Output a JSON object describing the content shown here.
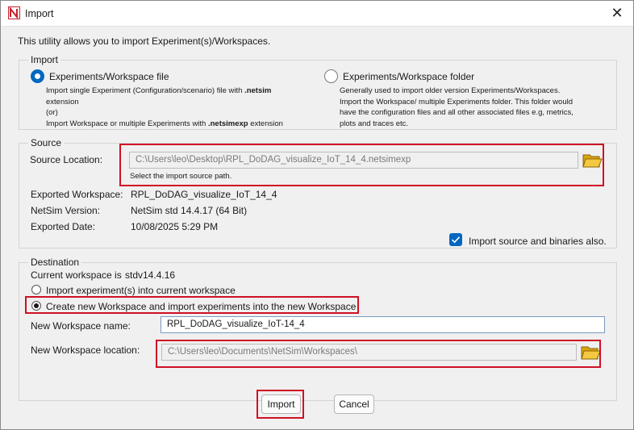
{
  "window": {
    "title": "Import",
    "app_icon": "netsim-logo-icon",
    "close_icon": "close-icon"
  },
  "intro": "This utility allows you to import Experiment(s)/Workspaces.",
  "import_group": {
    "title": "Import",
    "file_option": {
      "label": "Experiments/Workspace file",
      "selected": true,
      "desc": {
        "line1_pre": "Import single Experiment (Configuration/scenario) file with ",
        "line1_bold": ".netsim",
        "line2": "extension",
        "line3": "(or)",
        "line4_pre": "Import Workspace or multiple Experiments with ",
        "line4_bold": ".netsimexp",
        "line4_post": " extension"
      }
    },
    "folder_option": {
      "label": "Experiments/Workspace folder",
      "selected": false,
      "desc": {
        "line1": "Generally used to import older version Experiments/Workspaces.",
        "line2": "Import the Workspace/ multiple Experiments folder. This folder would",
        "line3": "have the configuration files and all other associated files e.g, metrics,",
        "line4": "plots and traces etc."
      }
    }
  },
  "source_group": {
    "title": "Source",
    "location_label": "Source Location:",
    "location_value": "C:\\Users\\leo\\Desktop\\RPL_DoDAG_visualize_IoT_14_4.netsimexp",
    "hint": "Select the import source path.",
    "folder_icon": "folder-icon",
    "exported_workspace_label": "Exported Workspace:",
    "exported_workspace_value": "RPL_DoDAG_visualize_IoT_14_4",
    "netsim_version_label": "NetSim Version:",
    "netsim_version_value": "NetSim std 14.4.17 (64 Bit)",
    "exported_date_label": "Exported Date:",
    "exported_date_value": "10/08/2025 5:29 PM",
    "import_binaries_label": "Import source and binaries also.",
    "import_binaries_checked": true
  },
  "destination_group": {
    "title": "Destination",
    "current_workspace_label": "Current workspace is",
    "current_workspace_value": "stdv14.4.16",
    "option_current_label": "Import experiment(s) into current workspace",
    "option_current_selected": false,
    "option_new_label": "Create new Workspace and import experiments into the new Workspace",
    "option_new_selected": true,
    "new_name_label": "New Workspace name:",
    "new_name_value": "RPL_DoDAG_visualize_IoT-14_4",
    "new_location_label": "New Workspace location:",
    "new_location_value": "C:\\Users\\leo\\Documents\\NetSim\\Workspaces\\"
  },
  "buttons": {
    "import_label": "Import",
    "cancel_label": "Cancel"
  },
  "colors": {
    "accent": "#0067c0",
    "highlight": "#d01025",
    "folder": "#f2c230"
  }
}
